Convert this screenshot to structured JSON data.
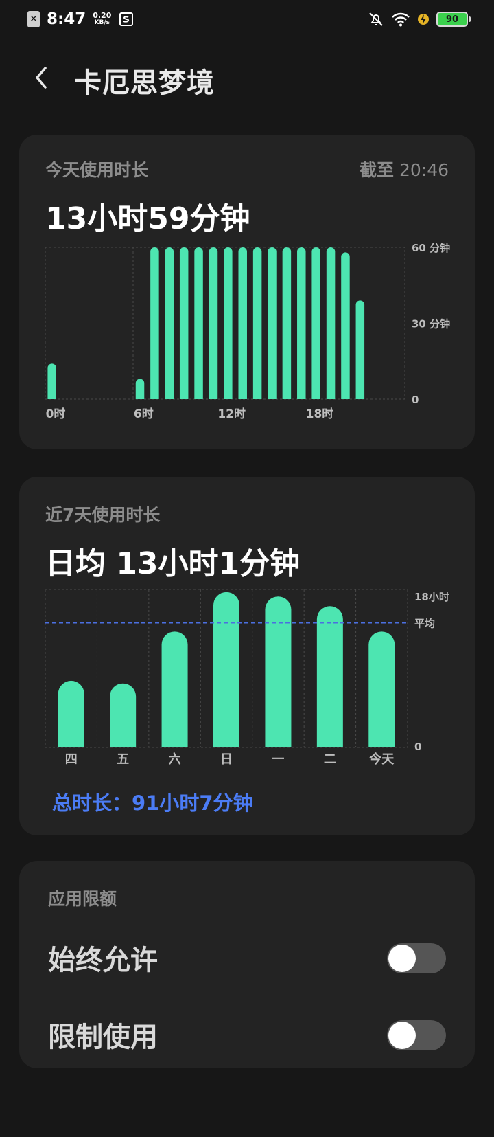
{
  "status_bar": {
    "time": "8:47",
    "net_speed_value": "0.20",
    "net_speed_unit": "KB/s",
    "battery": "90"
  },
  "header": {
    "title": "卡厄思梦境"
  },
  "today": {
    "label": "今天使用时长",
    "as_of_prefix": "截至",
    "as_of_time": "20:46",
    "total": "13小时59分钟",
    "chart_data": {
      "type": "bar",
      "title": "今天使用时长",
      "x_unit": "hour",
      "categories": [
        "0",
        "1",
        "2",
        "3",
        "4",
        "5",
        "6",
        "7",
        "8",
        "9",
        "10",
        "11",
        "12",
        "13",
        "14",
        "15",
        "16",
        "17",
        "18",
        "19",
        "20",
        "21",
        "22",
        "23"
      ],
      "values": [
        14,
        0,
        0,
        0,
        0,
        0,
        8,
        60,
        60,
        60,
        60,
        60,
        60,
        60,
        60,
        60,
        60,
        60,
        60,
        60,
        58,
        39,
        0,
        0
      ],
      "xtick_labels": [
        "0时",
        "6时",
        "12时",
        "18时"
      ],
      "ytick_labels": [
        "60 分钟",
        "30 分钟",
        "0"
      ],
      "ylim": [
        0,
        60
      ],
      "bar_color": "#4de5b1"
    }
  },
  "week": {
    "label": "近7天使用时长",
    "average": "日均 13小时1分钟",
    "total_prefix": "总时长：",
    "total_value": "91小时7分钟",
    "chart_data": {
      "type": "bar",
      "title": "近7天使用时长",
      "categories": [
        "四",
        "五",
        "六",
        "日",
        "一",
        "二",
        "今天"
      ],
      "values": [
        7.6,
        7.3,
        13.2,
        17.7,
        17.2,
        16.1,
        13.2
      ],
      "y_unit": "hours",
      "ylim": [
        0,
        18
      ],
      "average_line": 14.2,
      "ytick_labels": [
        "18小时",
        "平均",
        "0"
      ],
      "bar_color": "#4de5b1",
      "average_line_color": "#4b6fe0"
    }
  },
  "limits": {
    "label": "应用限额",
    "items": [
      {
        "label": "始终允许",
        "enabled": false
      },
      {
        "label": "限制使用",
        "enabled": false
      }
    ]
  }
}
